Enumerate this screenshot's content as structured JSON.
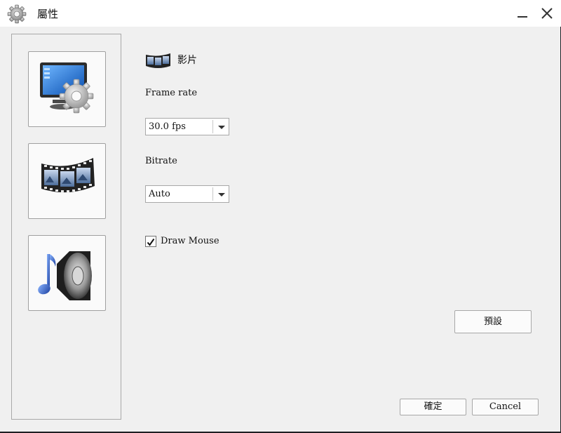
{
  "window": {
    "title": "屬性",
    "icons": {
      "app": "gear-icon",
      "minimize": "minimize-icon",
      "close": "close-icon"
    }
  },
  "sidebar": {
    "items": [
      {
        "id": "display",
        "icon": "monitor-settings-icon"
      },
      {
        "id": "video",
        "icon": "film-strip-icon",
        "selected": true
      },
      {
        "id": "audio",
        "icon": "speaker-music-icon"
      }
    ]
  },
  "section": {
    "icon": "film-strip-icon",
    "title": "影片"
  },
  "frame_rate": {
    "label": "Frame rate",
    "value": "30.0 fps"
  },
  "bitrate": {
    "label": "Bitrate",
    "value": "Auto"
  },
  "draw_mouse": {
    "label": "Draw Mouse",
    "checked": true
  },
  "buttons": {
    "default_label": "預設",
    "ok_label": "確定",
    "cancel_label": "Cancel"
  },
  "colors": {
    "window_bg": "#f0f0f0",
    "titlebar_bg": "#ffffff",
    "border": "#a8a8a8"
  }
}
